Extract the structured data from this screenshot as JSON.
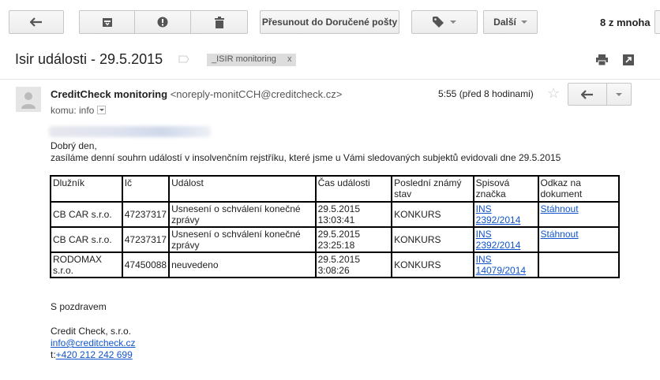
{
  "toolbar": {
    "move_label": "Přesunout do Doručené pošty",
    "more_label": "Další",
    "count": "8 z mnoha"
  },
  "icons": {
    "back": "arrow-left-icon",
    "archive": "archive-icon",
    "spam": "report-spam-icon",
    "delete": "trash-icon",
    "label": "tag-icon",
    "print": "print-icon",
    "popout": "new-window-icon",
    "reply": "reply-icon",
    "star": "star-icon"
  },
  "subject": {
    "title": "Isir události - 29.5.2015",
    "label": "_ISIR monitoring",
    "label_remove": "x"
  },
  "header": {
    "sender_name": "CreditCheck monitoring",
    "sender_email": "<noreply-monitCCH@creditcheck.cz>",
    "recipient": "komu: info",
    "time": "5:55 (před 8 hodinami)"
  },
  "body": {
    "greeting": "Dobrý den,",
    "intro": "zasíláme denní souhrn událostí v insolvenčním rejstříku, které jsme u Vámi sledovaných subjektů evidovali dne 29.5.2015",
    "table": {
      "headers": [
        "Dlužník",
        "Ič",
        "Událost",
        "Čas události",
        "Poslední známý stav",
        "Spisová značka",
        "Odkaz na dokument"
      ],
      "rows": [
        [
          "CB CAR s.r.o.",
          "47237317",
          "Usnesení o schválení konečné zprávy",
          "29.5.2015 13:03:41",
          "KONKURS",
          "INS 2392/2014",
          "Stáhnout"
        ],
        [
          "CB CAR s.r.o.",
          "47237317",
          "Usnesení o schválení konečné zprávy",
          "29.5.2015 23:25:18",
          "KONKURS",
          "INS 2392/2014",
          "Stáhnout"
        ],
        [
          "RODOMAX s.r.o.",
          "47450088",
          "neuvedeno",
          "29.5.2015 3:08:26",
          "KONKURS",
          "INS 14079/2014",
          ""
        ]
      ]
    },
    "signature": {
      "closing": "S pozdravem",
      "company": "Credit Check, s.r.o.",
      "email": "info@creditcheck.cz",
      "phone_prefix": "t:",
      "phone": "+420 212 242 699"
    }
  }
}
